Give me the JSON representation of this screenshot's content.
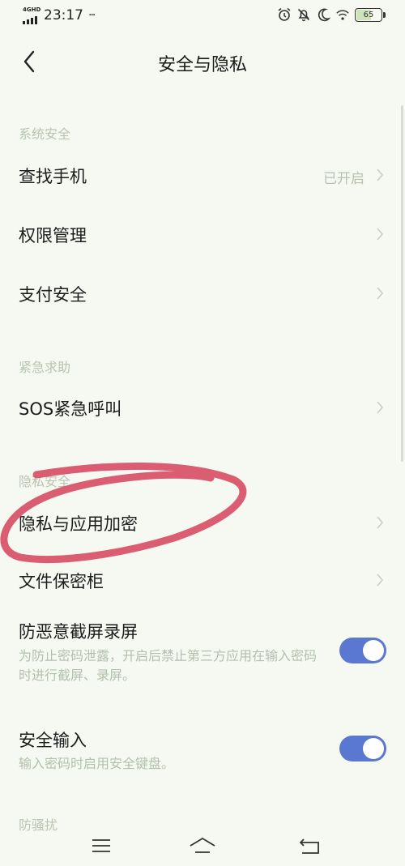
{
  "status_bar": {
    "network": "4GHD",
    "time": "23:17",
    "more": "···",
    "battery": "65"
  },
  "header": {
    "title": "安全与隐私"
  },
  "sections": [
    {
      "title": "系统安全",
      "items": [
        {
          "label": "查找手机",
          "value": "已开启"
        },
        {
          "label": "权限管理"
        },
        {
          "label": "支付安全"
        }
      ]
    },
    {
      "title": "紧急求助",
      "items": [
        {
          "label": "SOS紧急呼叫"
        }
      ]
    },
    {
      "title": "隐私安全",
      "items": [
        {
          "label": "隐私与应用加密"
        },
        {
          "label": "文件保密柜"
        },
        {
          "label": "防恶意截屏录屏",
          "description": "为防止密码泄露，开启后禁止第三方应用在输入密码时进行截屏、录屏。",
          "toggle": true
        },
        {
          "label": "安全输入",
          "description": "输入密码时启用安全键盘。",
          "toggle": true
        }
      ]
    },
    {
      "title": "防骚扰"
    }
  ],
  "colors": {
    "background": "#f6f9f2",
    "toggle_on": "#5a78d0",
    "annotation": "#d9546a",
    "secondary_text": "#b9c4b1"
  },
  "nav_bar": {
    "icons": [
      "menu-icon",
      "home-icon",
      "back-icon"
    ]
  }
}
